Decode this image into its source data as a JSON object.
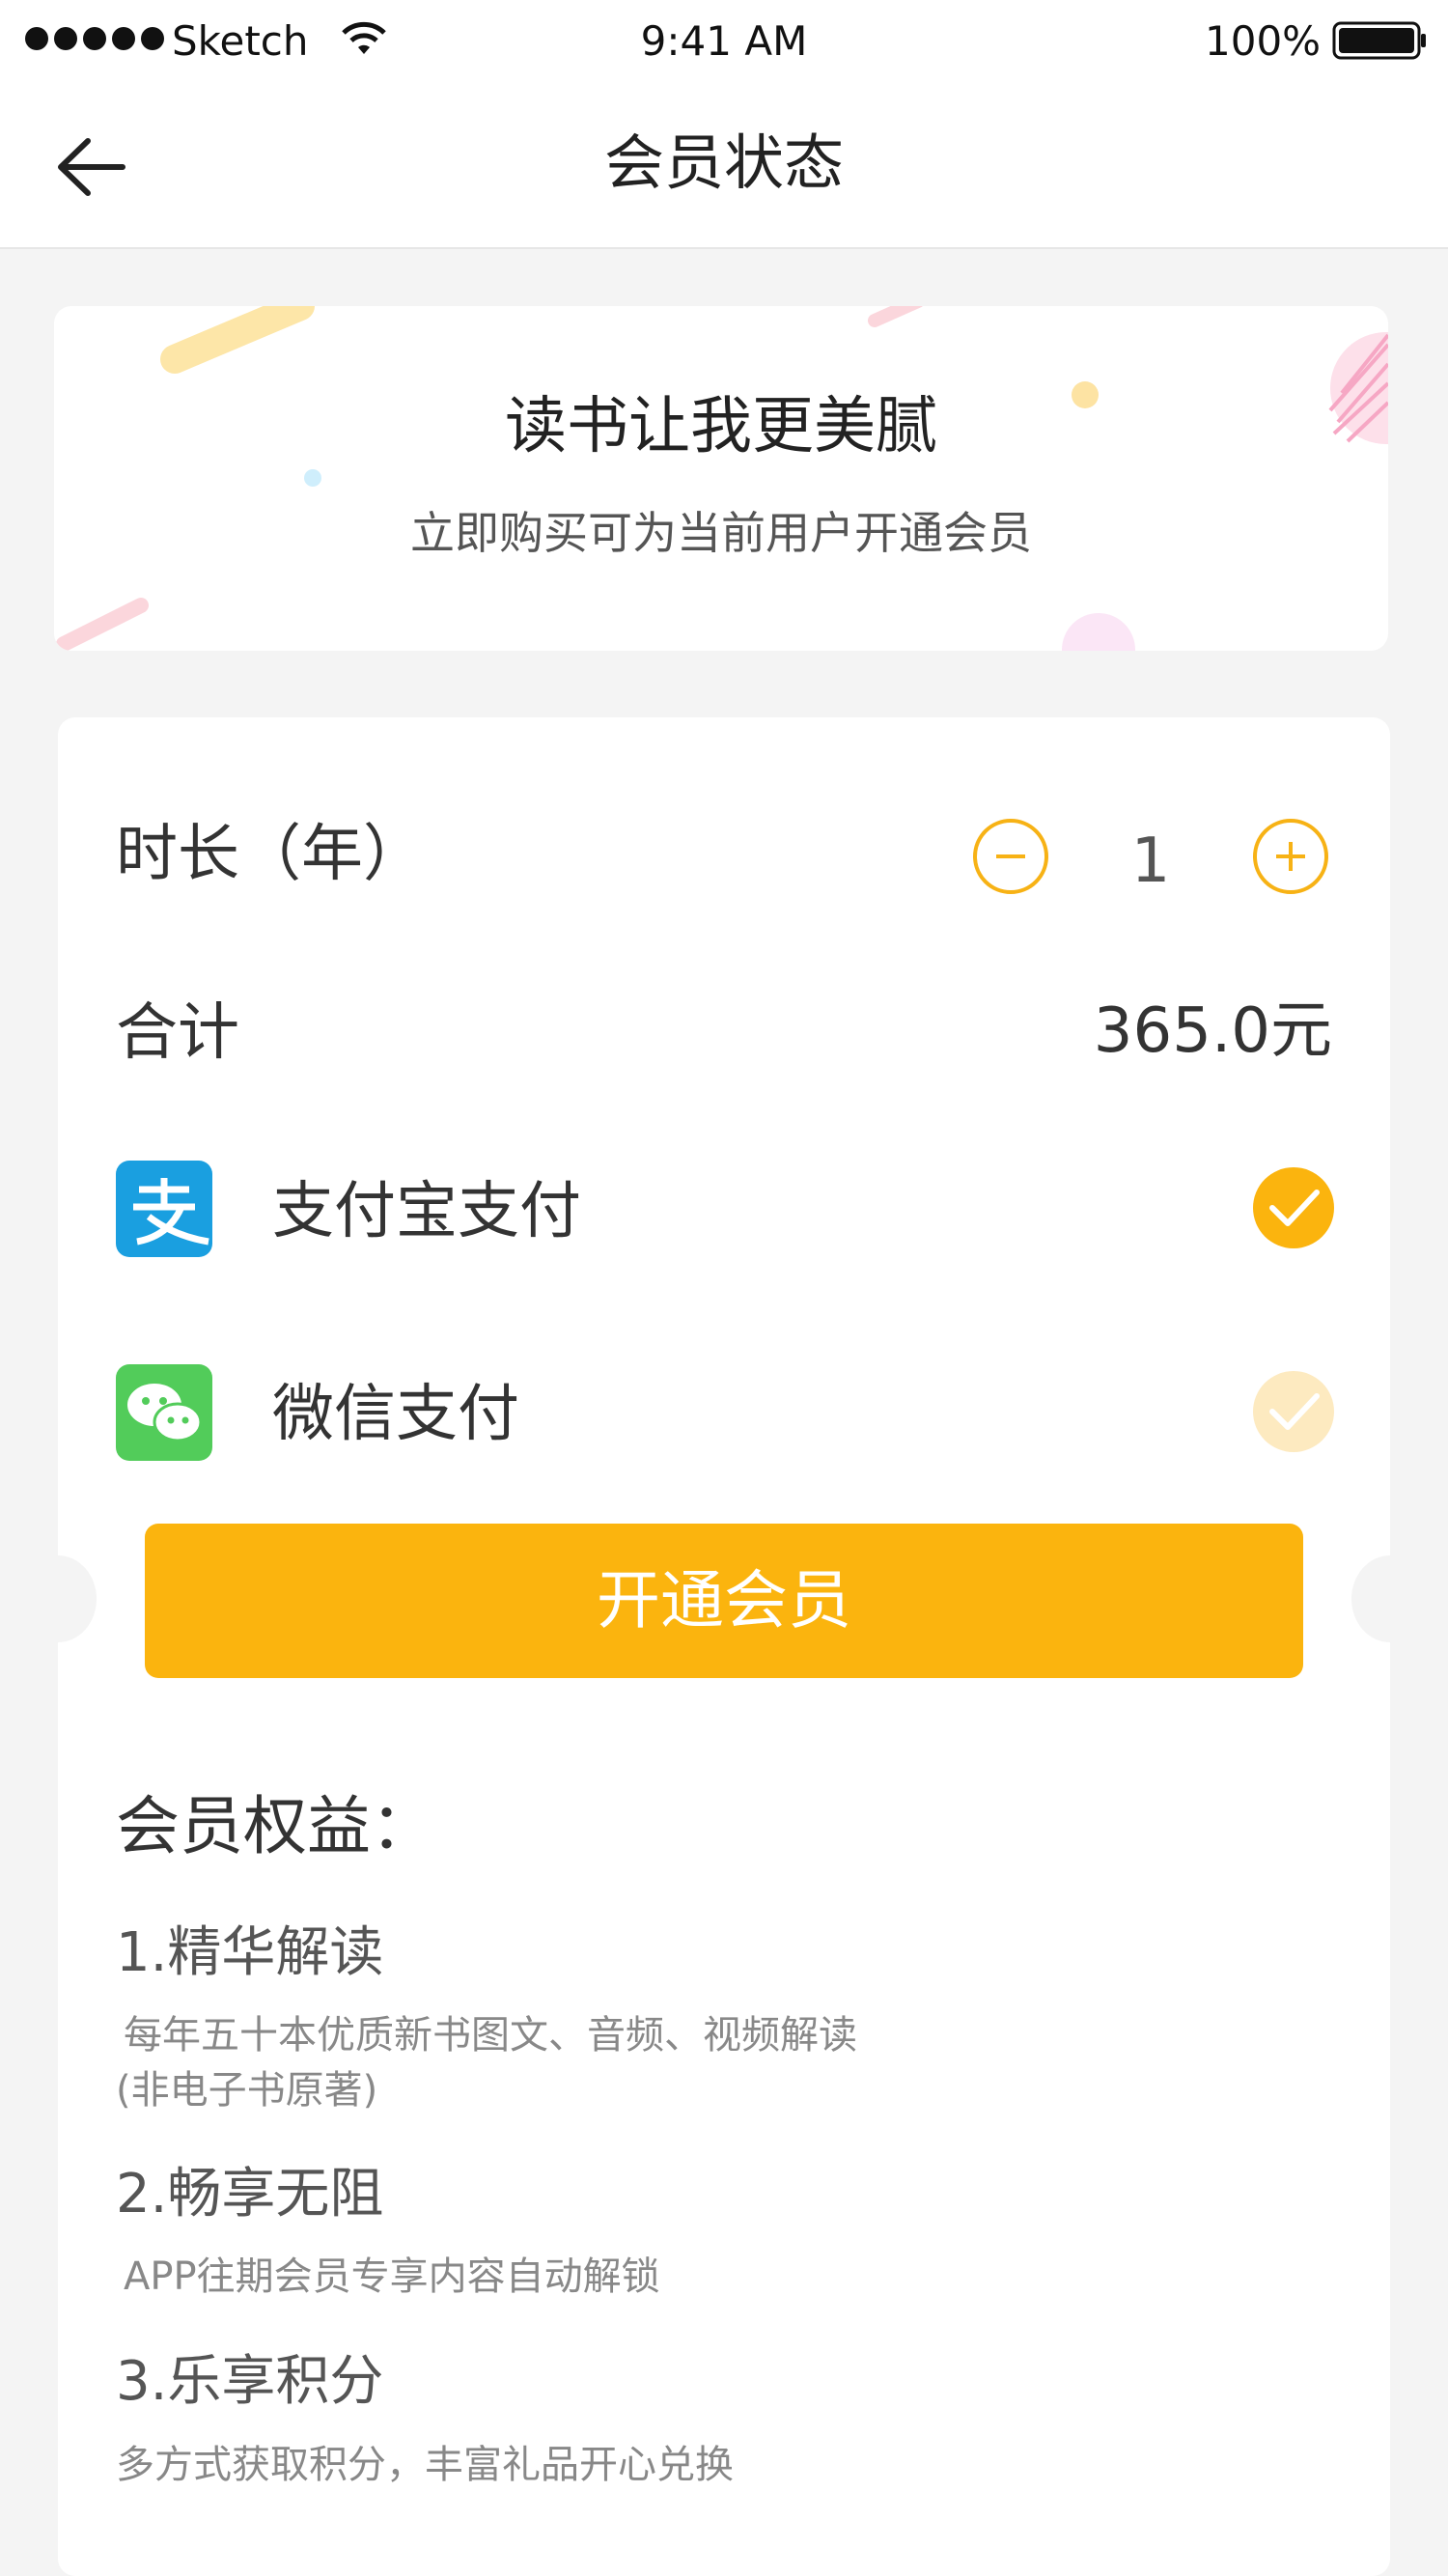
{
  "status_bar": {
    "carrier": "Sketch",
    "time": "9:41 AM",
    "battery": "100%"
  },
  "nav": {
    "title": "会员状态",
    "back_icon": "back-arrow-icon"
  },
  "banner": {
    "title": "读书让我更美腻",
    "subtitle": "立即购买可为当前用户开通会员"
  },
  "order": {
    "duration_label": "时长（年）",
    "quantity": "1",
    "total_label": "合计",
    "total_value": "365.0元"
  },
  "payment": {
    "options": [
      {
        "label": "支付宝支付",
        "icon": "alipay-icon",
        "selected": true
      },
      {
        "label": "微信支付",
        "icon": "wechat-icon",
        "selected": false
      }
    ]
  },
  "cta": {
    "label": "开通会员"
  },
  "benefits": {
    "title": "会员权益：",
    "items": [
      {
        "title": "1.精华解读",
        "desc": "每年五十本优质新书图文、音频、视频解读",
        "desc2": "(非电子书原著)"
      },
      {
        "title": "2.畅享无阻",
        "desc": "APP往期会员专享内容自动解锁"
      },
      {
        "title": "3.乐享积分",
        "desc": "多方式获取积分，丰富礼品开心兑换"
      }
    ]
  },
  "colors": {
    "accent": "#fbb40e",
    "alipay": "#1a9fe0",
    "wechat": "#52cc5a"
  }
}
